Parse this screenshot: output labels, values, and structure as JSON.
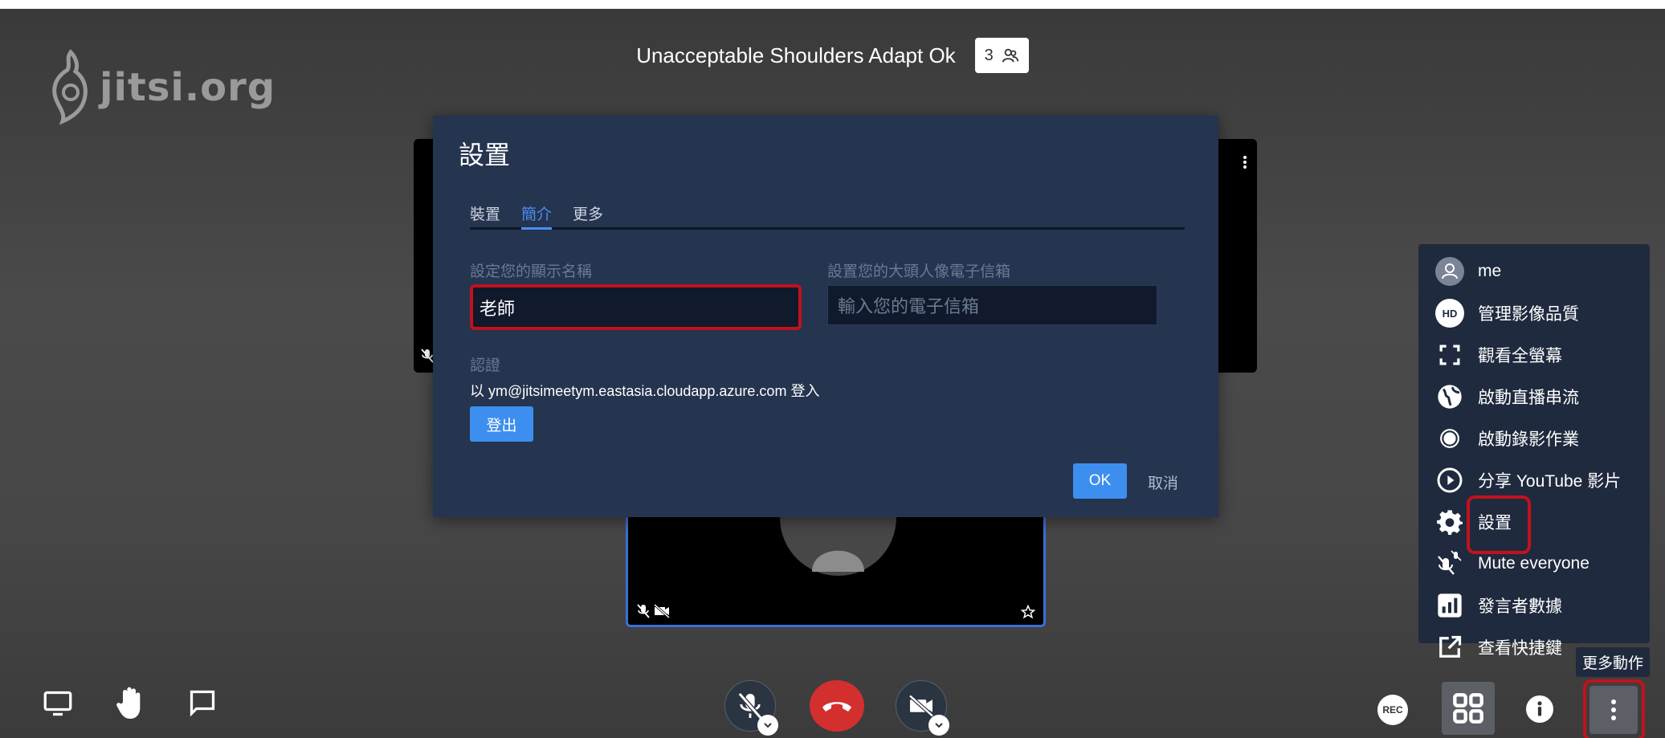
{
  "header": {
    "title": "Unacceptable Shoulders Adapt Ok",
    "participant_count": "3"
  },
  "logo": {
    "text": "jitsi.org"
  },
  "dialog": {
    "title": "設置",
    "tabs": [
      {
        "label": "裝置",
        "active": false
      },
      {
        "label": "簡介",
        "active": true
      },
      {
        "label": "更多",
        "active": false
      }
    ],
    "display_name_label": "設定您的顯示名稱",
    "display_name_value": "老師",
    "gravatar_label": "設置您的大頭人像電子信箱",
    "gravatar_placeholder": "輸入您的電子信箱",
    "auth_label": "認證",
    "auth_prefix": "以 ",
    "auth_email": "ym@jitsimeetym.eastasia.cloudapp.azure.com",
    "auth_suffix": " 登入",
    "logout_label": "登出",
    "ok_label": "OK",
    "cancel_label": "取消"
  },
  "menu": {
    "items": [
      {
        "label": "me",
        "icon": "avatar-icon"
      },
      {
        "label": "管理影像品質",
        "icon": "hd-icon"
      },
      {
        "label": "觀看全螢幕",
        "icon": "fullscreen-icon"
      },
      {
        "label": "啟動直播串流",
        "icon": "globe-icon"
      },
      {
        "label": "啟動錄影作業",
        "icon": "record-icon"
      },
      {
        "label": "分享 YouTube 影片",
        "icon": "play-icon"
      },
      {
        "label": "設置",
        "icon": "gear-icon"
      },
      {
        "label": "Mute everyone",
        "icon": "mute-everyone-icon"
      },
      {
        "label": "發言者數據",
        "icon": "stats-icon"
      },
      {
        "label": "查看快捷鍵",
        "icon": "external-link-icon"
      }
    ],
    "hd_badge": "HD",
    "tooltip": "更多動作"
  },
  "toolbar": {
    "rec_label": "REC"
  },
  "colors": {
    "accent": "#3d8fef",
    "highlight": "#c0121d",
    "hangup": "#d32f2f",
    "dialog_bg": "#25344f",
    "menu_bg": "#1f2a3e"
  }
}
